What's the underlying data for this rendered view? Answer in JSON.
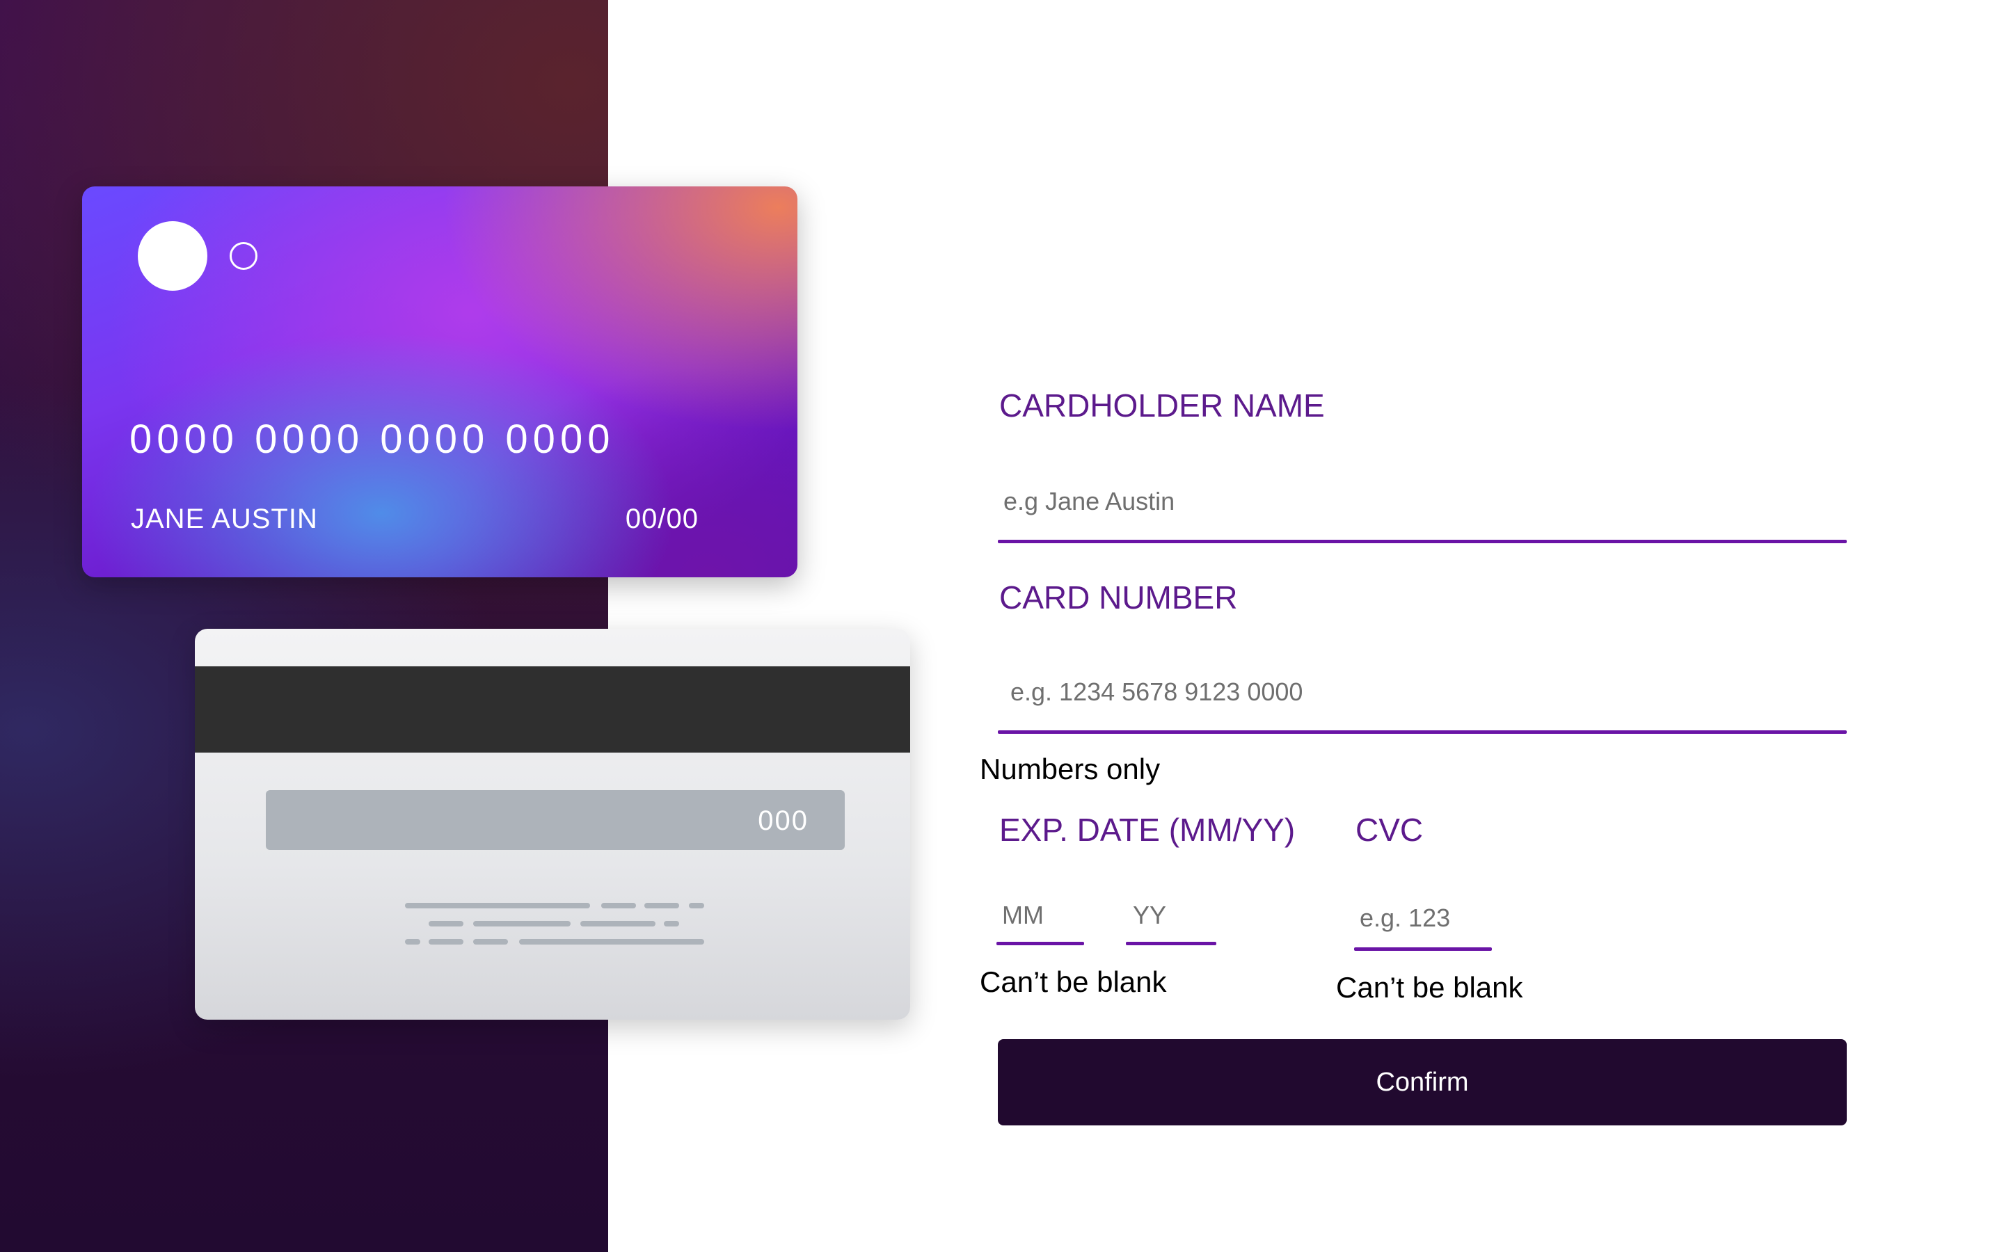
{
  "card_front": {
    "number": "0000 0000 0000 0000",
    "name": "JANE AUSTIN",
    "expiry": "00/00"
  },
  "card_back": {
    "cvc": "000"
  },
  "form": {
    "cardholder": {
      "label": "CARDHOLDER NAME",
      "placeholder": "e.g Jane Austin",
      "value": ""
    },
    "card_number": {
      "label": "CARD NUMBER",
      "placeholder": "e.g. 1234 5678 9123 0000",
      "value": "",
      "helper": "Numbers only"
    },
    "expiry": {
      "label": "EXP. DATE (MM/YY)",
      "month_placeholder": "MM",
      "year_placeholder": "YY",
      "helper": "Can’t be blank"
    },
    "cvc": {
      "label": "CVC",
      "placeholder": "e.g. 123",
      "helper": "Can’t be blank"
    },
    "confirm_label": "Confirm"
  },
  "colors": {
    "label": "#5c1a8c",
    "underline": "#6a14a6",
    "button": "#21092f",
    "side_panel": "#2a0d35"
  }
}
